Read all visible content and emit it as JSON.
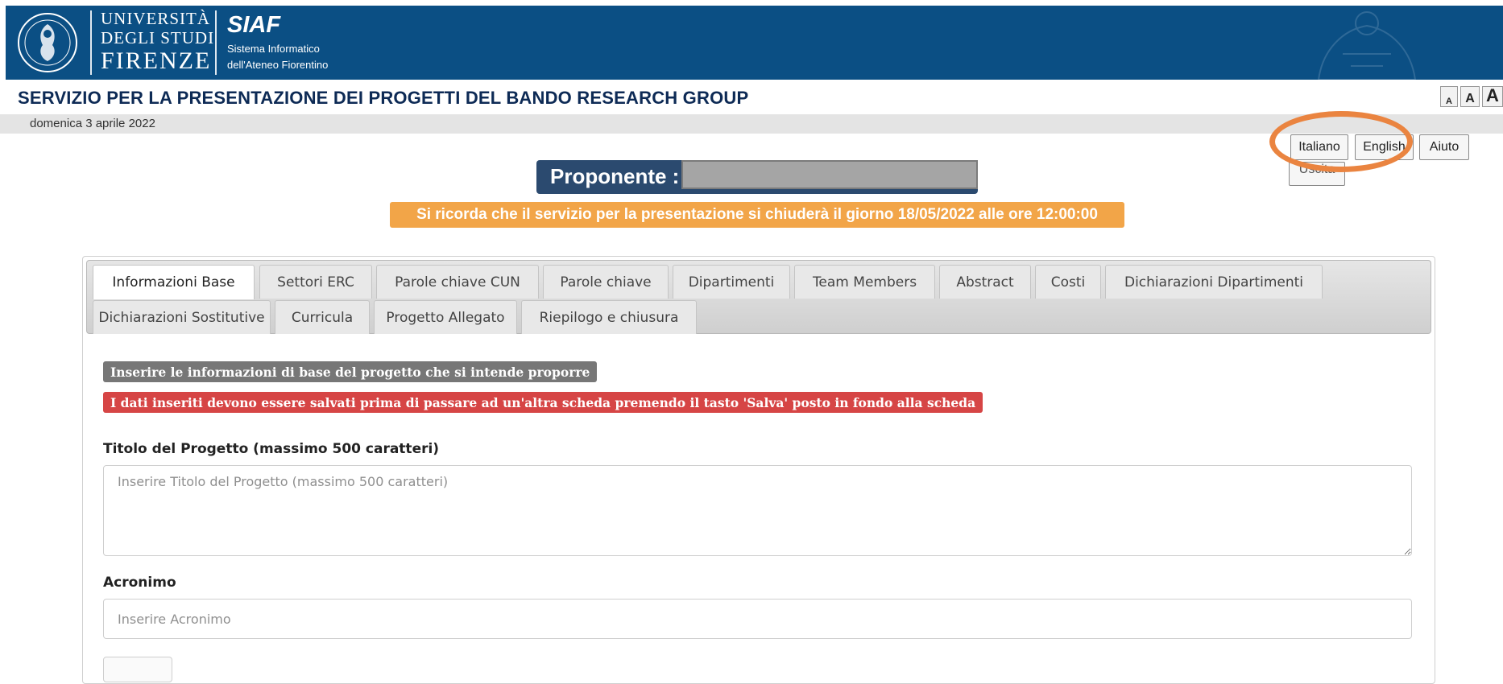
{
  "header": {
    "university_line1": "UNIVERSITÀ",
    "university_line2": "DEGLI STUDI",
    "university_line3": "FIRENZE",
    "siaf_name": "SIAF",
    "siaf_sub1": "Sistema Informatico",
    "siaf_sub2": "dell'Ateneo Fiorentino",
    "bg_color": "#0b4f84"
  },
  "service_title": "SERVIZIO PER LA PRESENTAZIONE DEI PROGETTI DEL BANDO RESEARCH GROUP",
  "font_size_controls": [
    "A",
    "A",
    "A"
  ],
  "date": "domenica 3 aprile 2022",
  "top_buttons": {
    "italiano": "Italiano",
    "english": "English",
    "aiuto": "Aiuto",
    "uscita": "Uscita"
  },
  "proponente_label": "Proponente :",
  "reminder": "Si ricorda che il servizio per la presentazione si chiuderà il giorno 18/05/2022 alle ore 12:00:00",
  "tabs": [
    {
      "label": "Informazioni Base",
      "active": true
    },
    {
      "label": "Settori ERC"
    },
    {
      "label": "Parole chiave CUN"
    },
    {
      "label": "Parole chiave"
    },
    {
      "label": "Dipartimenti"
    },
    {
      "label": "Team Members"
    },
    {
      "label": "Abstract"
    },
    {
      "label": "Costi"
    },
    {
      "label": "Dichiarazioni Dipartimenti"
    },
    {
      "label": "Dichiarazioni Sostitutive"
    },
    {
      "label": "Curricula"
    },
    {
      "label": "Progetto Allegato"
    },
    {
      "label": "Riepilogo e chiusura"
    }
  ],
  "messages": {
    "info": "Inserire le informazioni di base del progetto che si intende proporre",
    "warning": "I dati inseriti devono essere salvati prima di passare ad un'altra scheda premendo il tasto 'Salva' posto in fondo alla scheda"
  },
  "form": {
    "title_label": "Titolo del Progetto (massimo 500 caratteri)",
    "title_placeholder": "Inserire Titolo del Progetto (massimo 500 caratteri)",
    "title_value": "",
    "acronym_label": "Acronimo",
    "acronym_placeholder": "Inserire Acronimo",
    "acronym_value": ""
  },
  "colors": {
    "title_text": "#0d2a55",
    "reminder_bg": "#f2a548",
    "info_bg": "#777777",
    "warning_bg": "#d64545",
    "highlight": "#ea8440",
    "proponente_bg": "#2b4a6f"
  }
}
